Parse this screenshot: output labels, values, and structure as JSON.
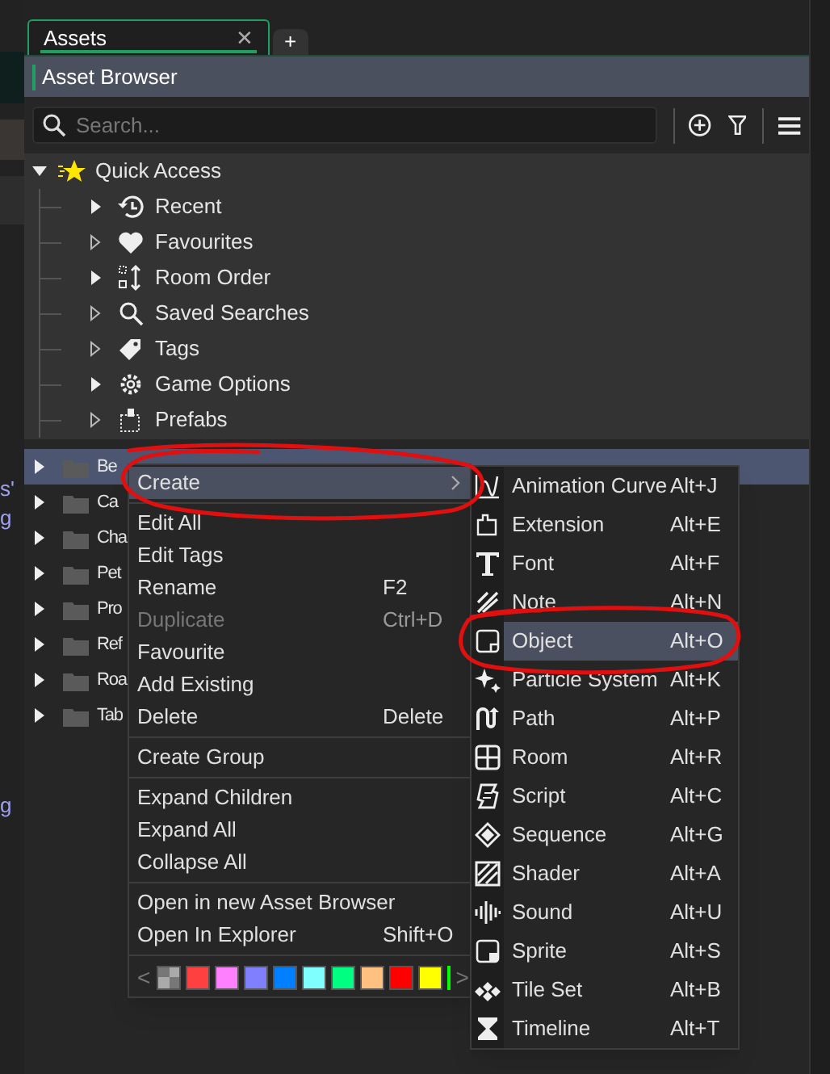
{
  "tabs": [
    {
      "label": "Assets",
      "selected": true,
      "close": "✕"
    },
    {
      "label": "+",
      "selected": false
    }
  ],
  "header": {
    "title": "Asset Browser"
  },
  "search": {
    "placeholder": "Search..."
  },
  "quick_access": {
    "label": "Quick Access",
    "expanded": true,
    "children": [
      {
        "label": "Recent",
        "has_children": true
      },
      {
        "label": "Favourites",
        "has_children": false
      },
      {
        "label": "Room Order",
        "has_children": true
      },
      {
        "label": "Saved Searches",
        "has_children": false
      },
      {
        "label": "Tags",
        "has_children": false
      },
      {
        "label": "Game Options",
        "has_children": true
      },
      {
        "label": "Prefabs",
        "has_children": false
      }
    ]
  },
  "folders": [
    {
      "label": "Be",
      "selected": true
    },
    {
      "label": "Ca",
      "selected": false
    },
    {
      "label": "Cha",
      "selected": false
    },
    {
      "label": "Pet",
      "selected": false
    },
    {
      "label": "Pro",
      "selected": false
    },
    {
      "label": "Ref",
      "selected": false
    },
    {
      "label": "Roa",
      "selected": false
    },
    {
      "label": "Tab",
      "selected": false
    }
  ],
  "edge_fragments": [
    "s'",
    "g",
    "g"
  ],
  "context_menu": {
    "groups": [
      [
        {
          "label": "Create",
          "submenu": true,
          "selected": true,
          "disabled": false
        }
      ],
      [
        {
          "label": "Edit All",
          "selected": false,
          "disabled": false
        },
        {
          "label": "Edit Tags",
          "selected": false,
          "disabled": false
        },
        {
          "label": "Rename",
          "shortcut": "F2",
          "selected": false,
          "disabled": false
        },
        {
          "label": "Duplicate",
          "shortcut": "Ctrl+D",
          "selected": false,
          "disabled": true
        },
        {
          "label": "Favourite",
          "selected": false,
          "disabled": false
        },
        {
          "label": "Add Existing",
          "selected": false,
          "disabled": false
        },
        {
          "label": "Delete",
          "shortcut": "Delete",
          "selected": false,
          "disabled": false
        }
      ],
      [
        {
          "label": "Create Group",
          "selected": false,
          "disabled": false
        }
      ],
      [
        {
          "label": "Expand Children",
          "selected": false,
          "disabled": false
        },
        {
          "label": "Expand All",
          "selected": false,
          "disabled": false
        },
        {
          "label": "Collapse All",
          "selected": false,
          "disabled": false
        }
      ],
      [
        {
          "label": "Open in new Asset Browser",
          "selected": false,
          "disabled": false
        },
        {
          "label": "Open In Explorer",
          "shortcut": "Shift+O",
          "selected": false,
          "disabled": false
        }
      ]
    ],
    "swatches": [
      {
        "kind": "none"
      },
      {
        "kind": "color",
        "color": "#ff4040"
      },
      {
        "kind": "color",
        "color": "#ff80ff"
      },
      {
        "kind": "color",
        "color": "#8080ff"
      },
      {
        "kind": "color",
        "color": "#0080ff"
      },
      {
        "kind": "color",
        "color": "#80ffff"
      },
      {
        "kind": "color",
        "color": "#00ff80"
      },
      {
        "kind": "color",
        "color": "#ffc080"
      },
      {
        "kind": "color",
        "color": "#ff0000"
      },
      {
        "kind": "color",
        "color": "#ffff00"
      },
      {
        "kind": "partial",
        "color": "#00ff00"
      }
    ],
    "prev": "<",
    "next": ">"
  },
  "create_submenu": [
    {
      "label": "Animation Curve",
      "shortcut": "Alt+J",
      "selected": false
    },
    {
      "label": "Extension",
      "shortcut": "Alt+E",
      "selected": false
    },
    {
      "label": "Font",
      "shortcut": "Alt+F",
      "selected": false
    },
    {
      "label": "Note",
      "shortcut": "Alt+N",
      "selected": false
    },
    {
      "label": "Object",
      "shortcut": "Alt+O",
      "selected": true
    },
    {
      "label": "Particle System",
      "shortcut": "Alt+K",
      "selected": false
    },
    {
      "label": "Path",
      "shortcut": "Alt+P",
      "selected": false
    },
    {
      "label": "Room",
      "shortcut": "Alt+R",
      "selected": false
    },
    {
      "label": "Script",
      "shortcut": "Alt+C",
      "selected": false
    },
    {
      "label": "Sequence",
      "shortcut": "Alt+G",
      "selected": false
    },
    {
      "label": "Shader",
      "shortcut": "Alt+A",
      "selected": false
    },
    {
      "label": "Sound",
      "shortcut": "Alt+U",
      "selected": false
    },
    {
      "label": "Sprite",
      "shortcut": "Alt+S",
      "selected": false
    },
    {
      "label": "Tile Set",
      "shortcut": "Alt+B",
      "selected": false
    },
    {
      "label": "Timeline",
      "shortcut": "Alt+T",
      "selected": false
    }
  ]
}
